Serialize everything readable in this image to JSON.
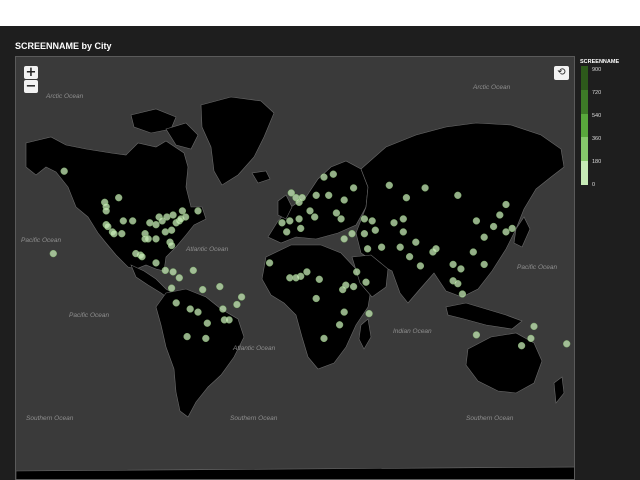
{
  "title": "SCREENNAME by City",
  "controls": {
    "zoom_in": "+",
    "zoom_out": "−",
    "reset": "⟲"
  },
  "legend": {
    "title": "SCREENNAME",
    "ticks": [
      "900",
      "720",
      "540",
      "360",
      "180",
      "0"
    ],
    "colors": [
      "#2d5a1b",
      "#3d7a27",
      "#59a83c",
      "#86c96b",
      "#c6eab6"
    ]
  },
  "oceans": {
    "arctic_left": "Arctic Ocean",
    "arctic_right": "Arctic Ocean",
    "pacific_left": "Pacific Ocean",
    "pacific_right": "Pacific Ocean",
    "atlantic_north": "Atlantic Ocean",
    "atlantic_south": "Atlantic Ocean",
    "pacific_south": "Pacific Ocean",
    "indian": "Indian Ocean",
    "southern_left": "Southern Ocean",
    "southern_mid": "Southern Ocean",
    "southern_right": "Southern Ocean"
  },
  "colors": {
    "land": "#000000",
    "water": "#3a3a3a",
    "border": "#6a6a6a",
    "marker": "#c6eab6"
  },
  "city_markers": [
    [
      -123,
      49
    ],
    [
      -122,
      47
    ],
    [
      -122,
      45
    ],
    [
      -122,
      38
    ],
    [
      -121,
      37
    ],
    [
      -118,
      34
    ],
    [
      -117,
      33
    ],
    [
      -112,
      33
    ],
    [
      -111,
      40
    ],
    [
      -105,
      40
    ],
    [
      -97,
      33
    ],
    [
      -97,
      30
    ],
    [
      -95,
      30
    ],
    [
      -94,
      39
    ],
    [
      -90,
      38
    ],
    [
      -90,
      30
    ],
    [
      -88,
      42
    ],
    [
      -86,
      40
    ],
    [
      -84,
      34
    ],
    [
      -83,
      42
    ],
    [
      -81,
      28
    ],
    [
      -80,
      26
    ],
    [
      -80,
      35
    ],
    [
      -79,
      43
    ],
    [
      -77,
      39
    ],
    [
      -75,
      40
    ],
    [
      -74,
      41
    ],
    [
      -73,
      45
    ],
    [
      -71,
      42
    ],
    [
      -63,
      45
    ],
    [
      -114,
      51
    ],
    [
      -100,
      20
    ],
    [
      -99,
      19
    ],
    [
      -103,
      21
    ],
    [
      -90,
      15
    ],
    [
      -84,
      10
    ],
    [
      -79,
      9
    ],
    [
      -75,
      5
    ],
    [
      -66,
      10
    ],
    [
      -80,
      -2
    ],
    [
      -77,
      -12
    ],
    [
      -70,
      -33
    ],
    [
      -68,
      -16
    ],
    [
      -58,
      -34
    ],
    [
      -63,
      -18
    ],
    [
      -47,
      -16
    ],
    [
      -46,
      -23
    ],
    [
      -43,
      -23
    ],
    [
      -38,
      -13
    ],
    [
      -35,
      -8
    ],
    [
      -60,
      -3
    ],
    [
      -49,
      -1
    ],
    [
      -57,
      -25
    ],
    [
      -9,
      39
    ],
    [
      -4,
      40
    ],
    [
      2,
      41
    ],
    [
      -3,
      53
    ],
    [
      0,
      51
    ],
    [
      2,
      49
    ],
    [
      4,
      51
    ],
    [
      9,
      45
    ],
    [
      12,
      42
    ],
    [
      13,
      52
    ],
    [
      18,
      59
    ],
    [
      24,
      60
    ],
    [
      21,
      52
    ],
    [
      26,
      44
    ],
    [
      29,
      41
    ],
    [
      37,
      55
    ],
    [
      31,
      50
    ],
    [
      -6,
      34
    ],
    [
      3,
      36
    ],
    [
      31,
      30
    ],
    [
      36,
      33
    ],
    [
      44,
      33
    ],
    [
      46,
      24
    ],
    [
      55,
      25
    ],
    [
      51,
      35
    ],
    [
      69,
      34
    ],
    [
      67,
      25
    ],
    [
      73,
      19
    ],
    [
      77,
      28
    ],
    [
      80,
      13
    ],
    [
      88,
      22
    ],
    [
      90,
      24
    ],
    [
      101,
      14
    ],
    [
      106,
      11
    ],
    [
      101,
      3
    ],
    [
      104,
      1
    ],
    [
      107,
      -6
    ],
    [
      121,
      14
    ],
    [
      114,
      22
    ],
    [
      121,
      31
    ],
    [
      116,
      40
    ],
    [
      127,
      37
    ],
    [
      139,
      36
    ],
    [
      135,
      34
    ],
    [
      151,
      -34
    ],
    [
      145,
      -38
    ],
    [
      153,
      -27
    ],
    [
      116,
      -32
    ],
    [
      174,
      -37
    ],
    [
      3,
      6
    ],
    [
      0,
      5
    ],
    [
      7,
      9
    ],
    [
      32,
      0
    ],
    [
      37,
      -1
    ],
    [
      39,
      9
    ],
    [
      28,
      -26
    ],
    [
      18,
      -34
    ],
    [
      31,
      -18
    ],
    [
      13,
      -9
    ],
    [
      47,
      -19
    ],
    [
      45,
      2
    ],
    [
      30,
      -3
    ],
    [
      15,
      4
    ],
    [
      -17,
      15
    ],
    [
      -4,
      5
    ],
    [
      60,
      56
    ],
    [
      83,
      55
    ],
    [
      104,
      52
    ],
    [
      131,
      43
    ],
    [
      135,
      48
    ],
    [
      71,
      51
    ],
    [
      69,
      41
    ],
    [
      49,
      40
    ],
    [
      44,
      41
    ],
    [
      63,
      39
    ],
    [
      -156,
      21
    ],
    [
      -149,
      61
    ]
  ]
}
